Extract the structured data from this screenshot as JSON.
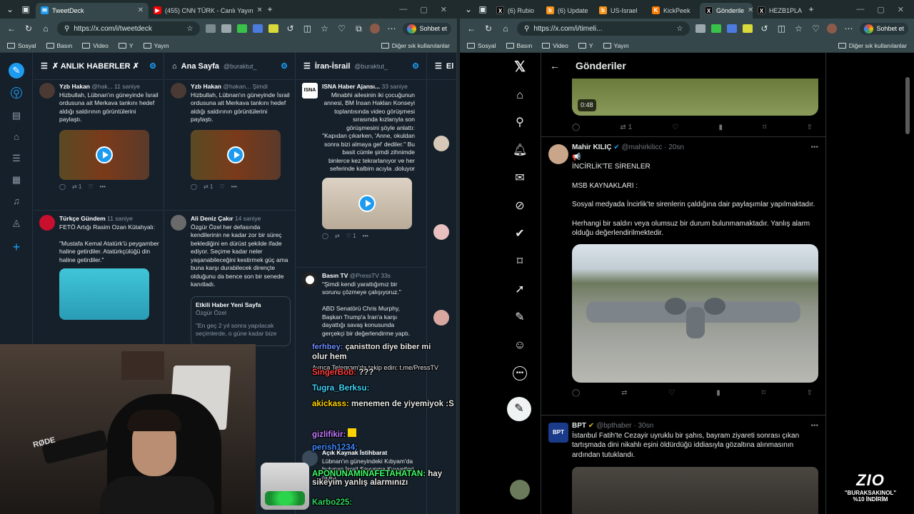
{
  "left_browser": {
    "tabs": [
      {
        "title": "TweetDeck",
        "fav": "X",
        "color": "#1d9bf0",
        "active": true
      },
      {
        "title": "(455) CNN TÜRK - Canlı Yayın",
        "fav": "▶",
        "color": "#ff0000"
      }
    ],
    "url": "https://x.com/i/tweetdeck",
    "bookmarks": [
      "Sosyal",
      "Basın",
      "Video",
      "Y",
      "Yayın"
    ],
    "other_bookmarks": "Diğer sık kullanılanlar",
    "sohbet": "Sohbet et"
  },
  "right_browser": {
    "tabs": [
      {
        "title": "(6) Rubio",
        "fav": "X",
        "color": "#000"
      },
      {
        "title": "(6) Update",
        "fav": "b",
        "color": "#f7931a"
      },
      {
        "title": "US-Israel",
        "fav": "b",
        "color": "#f7931a"
      },
      {
        "title": "KickPeek",
        "fav": "K",
        "color": "#ff7a00"
      },
      {
        "title": "Gönderile",
        "fav": "X",
        "color": "#000",
        "active": true
      },
      {
        "title": "HEZB1PLA",
        "fav": "X",
        "color": "#000"
      }
    ],
    "url": "https://x.com/i/timeli...",
    "bookmarks": [
      "Sosyal",
      "Basın",
      "Video",
      "Y",
      "Yayın"
    ],
    "other_bookmarks": "Diğer sık kullanılanlar",
    "sohbet": "Sohbet et"
  },
  "tweetdeck": {
    "columns": [
      {
        "title": "✗ ANLIK HABERLER ✗",
        "handle": ""
      },
      {
        "title": "Ana Sayfa",
        "handle": "@buraktut_"
      },
      {
        "title": "İran-İsrail",
        "handle": "@buraktut_"
      },
      {
        "title": "El",
        "handle": ""
      }
    ],
    "c1": [
      {
        "name": "Yzb Hakan",
        "handle": "@hak...",
        "time": "11 saniye",
        "text": "Hizbullah, Lübnan'ın güneyinde İsrail ordusuna ait Merkava tankını hedef aldığı saldırının görüntülerini paylaştı.",
        "rt": "1"
      },
      {
        "name": "Türkçe Gündem",
        "handle": "",
        "time": "11 saniye",
        "text": "FETÖ Artığı Rasim Ozan Kütahyalı:\n\n\"Mustafa Kemal Atatürk'ü peygamber haline getirdiler. Atatürkçülüğü din haline getirdiler.\"",
        "rt": "1"
      }
    ],
    "c2": [
      {
        "name": "Yzb Hakan",
        "handle": "@hakan...",
        "time": "Şimdi",
        "text": "Hizbullah, Lübnan'ın güneyinde İsrail ordusuna ait Merkava tankını hedef aldığı saldırının görüntülerini paylaştı.",
        "rt": "1"
      },
      {
        "name": "Ali Deniz Çakır",
        "handle": "",
        "time": "14 saniye",
        "text": "Özgür Özel her defasında kendilerinin ne kadar zor bir süreç beklediğini en dürüst şekilde ifade ediyor. Seçime kadar neler yaşanabileceğini kestirmek güç ama buna karşı durabilecek dirençte olduğunu da bence son bir senede kanıtladı."
      },
      {
        "name": "Etkili Haber Yeni Sayfa",
        "handle": "Özgür Özel",
        "text": "\"En geç 2 yıl sonra yapılacak seçimlerde, o güne kadar bize"
      }
    ],
    "c3": [
      {
        "name": "ISNA Haber Ajansı...",
        "time": "33 saniye",
        "text": "Minabhi ailesinin iki çocuğunun annesi, BM İnsan Hakları Konseyi toplantısında video görüşmesi sırasında kızlarıyla son görüşmesini şöyle anlattı: \"Kapıdan çıkarken, 'Anne, okuldan sonra bizi almaya gel' dediler.\" Bu basit cümle şimdi zihnimde binlerce kez tekrarlanıyor ve her seferinde kalbim acıyla .doluyor",
        "rt": "1"
      },
      {
        "name": "Basın TV",
        "handle": "@PressTV",
        "time": "33s",
        "text": "\"Şimdi kendi yarattığımız bir sorunu çözmeye çalışıyoruz.\"\n\nABD Senatörü Chris Murphy, Başkan Trump'a İran'a karşı dayattığı savaş konusunda gerçekçi bir değerlendirme yaptı."
      },
      {
        "name": "Açık Kaynak İstihbarat",
        "text": "Lübnan'ın güneyindeki Kıbyam'da bulunan İsrail Savunma Kuvvetleri (IDF)."
      }
    ]
  },
  "chat": [
    {
      "user": "ferhbey:",
      "color": "#6a8cff",
      "msg": "çanistton diye biber mi"
    },
    {
      "user": "",
      "color": "#fff",
      "msg": "olur hem"
    },
    {
      "user": "",
      "color": "#fff",
      "msg": "Ayrıca Telegram'da takip edin: t.me/PressTV"
    },
    {
      "user": "SingerBob:",
      "color": "#ff4040",
      "msg": "???"
    },
    {
      "user": "Tugra_Berksu:",
      "color": "#3fd6ff",
      "msg": ""
    },
    {
      "user": "akickass:",
      "color": "#ffd400",
      "msg": "menemen de yiyemiyok :S"
    },
    {
      "user": "gizlifikir:",
      "color": "#c07bff",
      "msg": ""
    },
    {
      "user": "perish1234:",
      "color": "#3f88ff",
      "msg": ""
    },
    {
      "user": "APONUNAMINAFETAHATAN:",
      "color": "#3fff6a",
      "msg": "hay sikeyim yanlış alarmınızı"
    },
    {
      "user": "Karbo225:",
      "color": "#2fd660",
      "msg": ""
    }
  ],
  "x": {
    "header": "Gönderiler",
    "video_time": "0:48",
    "top_rt": "1",
    "tweets": [
      {
        "name": "Mahir KILIÇ",
        "handle": "@mahirkilicc",
        "time": "20sn",
        "lines": [
          "📢",
          "İNCİRLİK'TE SİRENLER",
          "",
          "MSB KAYNAKLARI :",
          "",
          "Sosyal medyada İncirlik'te sirenlerin çaldığına dair paylaşımlar yapılmaktadır.",
          "",
          "Herhangi bir saldırı veya olumsuz bir durum bulunmamaktadır. Yanlış alarm olduğu değerlendirilmektedir."
        ]
      },
      {
        "name": "BPT",
        "handle": "@bpthaber",
        "time": "30sn",
        "text": "İstanbul Fatih'te Cezayir uyruklu bir şahıs, bayram ziyareti sonrası çıkan tartışmada dini nikahlı eşini öldürdüğü iddiasıyla gözaltına alınmasının ardından tutuklandı."
      }
    ]
  },
  "promo": {
    "logo": "ZIO",
    "code": "\"BURAKSAKINOL\"",
    "discount": "%10 İNDİRİM"
  },
  "mic": "RØDE"
}
